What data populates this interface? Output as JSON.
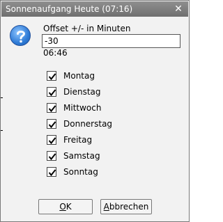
{
  "window": {
    "title": "Sonnenaufgang Heute (07:16)",
    "close_glyph": "✕"
  },
  "dialog": {
    "icon": "question-icon",
    "offset_label": "Offset +/- in Minuten",
    "offset_value": "-30",
    "result_time": "06:46"
  },
  "days": [
    {
      "label": "Montag",
      "checked": true
    },
    {
      "label": "Dienstag",
      "checked": true
    },
    {
      "label": "Mittwoch",
      "checked": true
    },
    {
      "label": "Donnerstag",
      "checked": true
    },
    {
      "label": "Freitag",
      "checked": true
    },
    {
      "label": "Samstag",
      "checked": true
    },
    {
      "label": "Sonntag",
      "checked": true
    }
  ],
  "buttons": {
    "ok_mnemonic": "O",
    "ok_rest": "K",
    "cancel_mnemonic": "A",
    "cancel_rest": "bbrechen"
  },
  "colors": {
    "titlebar": "#7f7f7f",
    "background": "#f2f2f2",
    "icon_blue": "#2f7bd6"
  }
}
